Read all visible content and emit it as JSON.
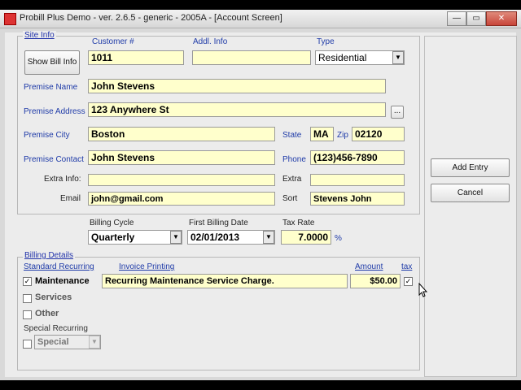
{
  "window": {
    "title": "Probill Plus Demo - ver. 2.6.5 - generic - 2005A - [Account Screen]",
    "min": "—",
    "max": "▭",
    "close": "✕"
  },
  "site_info": {
    "legend": "Site Info",
    "show_bill_info": "Show Bill Info",
    "customer_label": "Customer #",
    "customer_value": "1011",
    "addl_info_label": "Addl. Info",
    "addl_info_value": "",
    "type_label": "Type",
    "type_value": "Residential",
    "premise_name_label": "Premise Name",
    "premise_name_value": "John Stevens",
    "premise_address_label": "Premise Address",
    "premise_address_value": "123 Anywhere St",
    "ellipsis": "...",
    "premise_city_label": "Premise City",
    "premise_city_value": "Boston",
    "state_label": "State",
    "state_value": "MA",
    "zip_label": "Zip",
    "zip_value": "02120",
    "premise_contact_label": "Premise Contact",
    "premise_contact_value": "John Stevens",
    "phone_label": "Phone",
    "phone_value": "(123)456-7890",
    "extra_info_label": "Extra Info:",
    "extra_info_value": "",
    "extra_label": "Extra",
    "extra_value": "",
    "email_label": "Email",
    "email_value": "john@gmail.com",
    "sort_label": "Sort",
    "sort_value": "Stevens John"
  },
  "billing": {
    "cycle_label": "Billing Cycle",
    "cycle_value": "Quarterly",
    "first_date_label": "First Billing Date",
    "first_date_value": "02/01/2013",
    "tax_rate_label": "Tax Rate",
    "tax_rate_value": "7.0000",
    "percent": "%"
  },
  "billing_details": {
    "legend": "Billing Details",
    "standard_recurring": "Standard Recurring",
    "invoice_printing": "Invoice Printing",
    "amount": "Amount",
    "tax": "tax",
    "maintenance_label": "Maintenance",
    "maintenance_text": "Recurring Maintenance Service Charge.",
    "maintenance_amount": "$50.00",
    "check_mark": "✓",
    "services_label": "Services",
    "other_label": "Other",
    "special_recurring": "Special Recurring",
    "special_value": "Special"
  },
  "actions": {
    "add_entry": "Add Entry",
    "cancel": "Cancel"
  },
  "icons": {
    "dropdown": "▼",
    "cursor": "pointer-cursor-icon"
  }
}
